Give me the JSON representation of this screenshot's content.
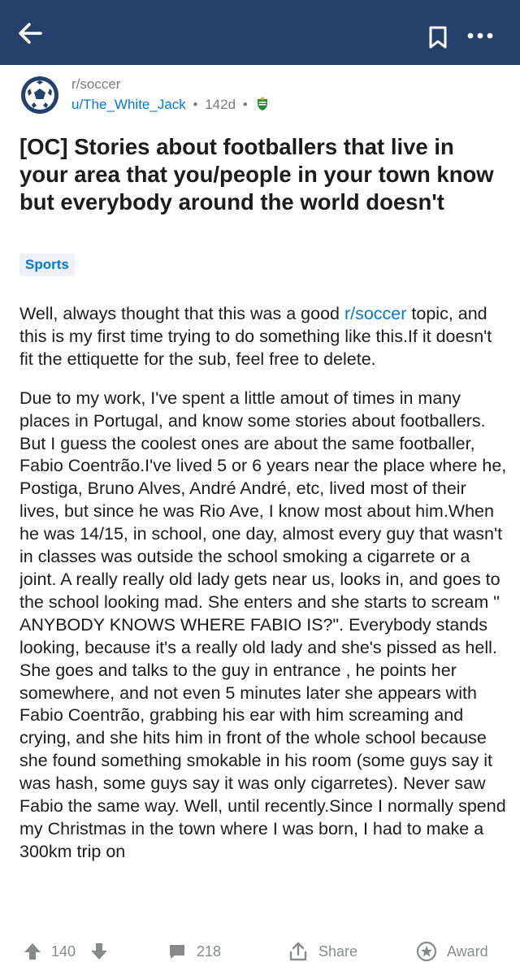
{
  "post": {
    "subreddit": "r/soccer",
    "author": "u/The_White_Jack",
    "age": "142d",
    "separator": "•",
    "title": "[OC] Stories about footballers that live in your area that you/people in your town know but everybody around the world doesn't",
    "flair": "Sports",
    "body": {
      "p1_before": "Well, always thought that this was a good ",
      "p1_link": "r/soccer",
      "p1_after": " topic, and this is my first time trying to do something like this.If it doesn't fit the ettiquette for the sub, feel free to delete.",
      "p2": "Due to my work, I've spent a little amout of times in many places in Portugal, and know some stories about footballers. But I guess the coolest ones are about the same footballer, Fabio Coentrão.I've lived 5 or 6 years near the place where he, Postiga, Bruno Alves, André André, etc, lived most of their lives, but since he was Rio Ave, I know most about him.When he was 14/15, in school, one day, almost every guy that wasn't in classes was outside the school smoking a cigarrete or a joint. A really really old lady gets near us, looks in, and goes to the school looking mad. She enters and she starts to scream \" ANYBODY KNOWS WHERE FABIO IS?\". Everybody stands looking, because it's a really old lady and she's pissed as hell. She goes and talks to the guy in entrance , he points her somewhere, and not even 5 minutes later she appears with Fabio Coentrão, grabbing his ear with him screaming and crying, and she hits him in front of the whole school because she found something smokable in his room (some guys say it was hash, some guys say it was only cigarretes). Never saw Fabio the same way. Well, until recently.Since I normally spend my Christmas in the town where I was born, I had to make a 300km trip on"
    }
  },
  "actions": {
    "votes": "140",
    "comments": "218",
    "share": "Share",
    "award": "Award"
  },
  "icons": {
    "back": "back-arrow-icon",
    "save": "bookmark-icon",
    "more": "more-options-icon",
    "avatar": "soccer-ball-icon",
    "flair": "sporting-crest-icon",
    "upvote": "upvote-arrow-icon",
    "downvote": "downvote-arrow-icon",
    "comments": "comment-bubble-icon",
    "share": "share-icon",
    "award": "award-star-icon"
  },
  "colors": {
    "header": "#24416b",
    "link": "#0079d3",
    "meta": "#7c7c7c",
    "action": "#878a8c",
    "flair_bg": "#edf1f6"
  }
}
